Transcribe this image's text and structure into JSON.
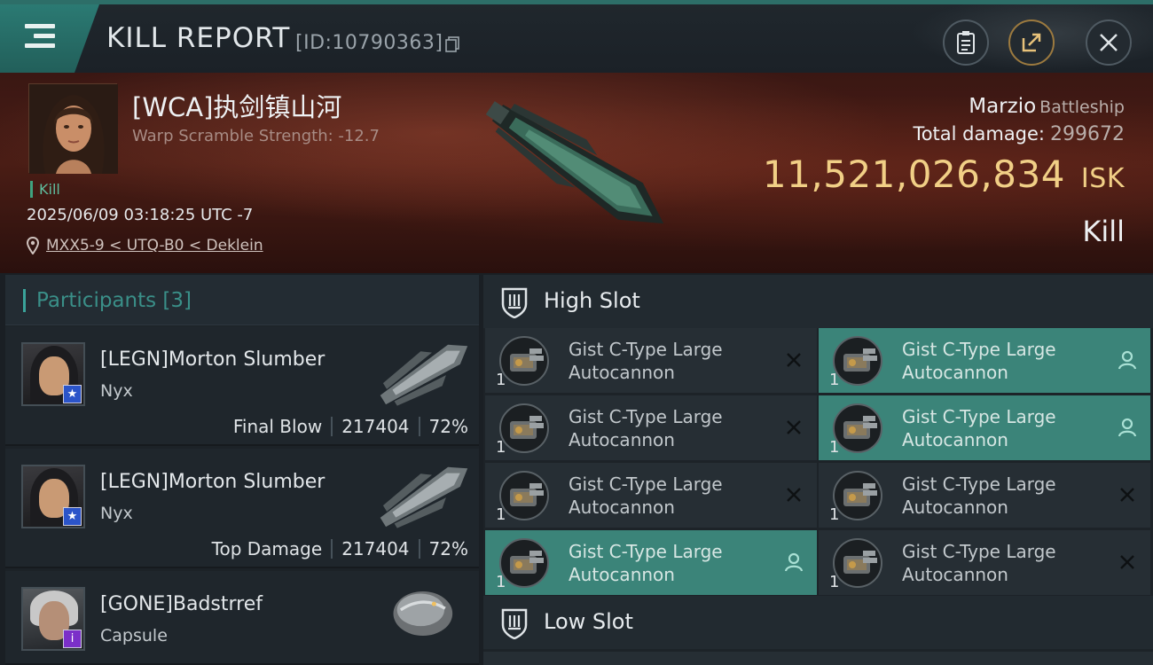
{
  "header": {
    "title": "KILL REPORT",
    "report_id": "[ID:10790363]",
    "icons": [
      "menu-icon",
      "copy-icon",
      "clipboard-icon",
      "share-icon",
      "close-icon"
    ]
  },
  "victim": {
    "name": "[WCA]执剑镇山河",
    "warp_scramble": "Warp Scramble Strength: -12.7",
    "kill_tag": "Kill",
    "timestamp": "2025/06/09 03:18:25 UTC -7",
    "location": "MXX5-9 < UTQ-B0 < Deklein",
    "ship_name": "Marzio",
    "ship_class": "Battleship",
    "total_damage_label": "Total damage:",
    "total_damage": "299672",
    "isk_value": "11,521,026,834",
    "isk_unit": "ISK",
    "result": "Kill"
  },
  "participants": {
    "label": "Participants",
    "count": "[3]",
    "rows": [
      {
        "name": "[LEGN]Morton Slumber",
        "ship": "Nyx",
        "role": "Final Blow",
        "damage": "217404",
        "percent": "72%",
        "badge": "★",
        "badge_color": "#2b54c9"
      },
      {
        "name": "[LEGN]Morton Slumber",
        "ship": "Nyx",
        "role": "Top Damage",
        "damage": "217404",
        "percent": "72%",
        "badge": "★",
        "badge_color": "#2b54c9"
      },
      {
        "name": "[GONE]Badstrref",
        "ship": "Capsule",
        "role": "",
        "damage": "",
        "percent": "",
        "badge": "i",
        "badge_color": "#7b2fc9"
      }
    ]
  },
  "slots": {
    "high_slot_label": "High Slot",
    "low_slot_label": "Low Slot",
    "modules": [
      {
        "name_line1": "Gist C-Type Large",
        "name_line2": "Autocannon",
        "qty": "1",
        "state": "destroyed",
        "active": false
      },
      {
        "name_line1": "Gist C-Type Large",
        "name_line2": "Autocannon",
        "qty": "1",
        "state": "dropped",
        "active": true
      },
      {
        "name_line1": "Gist C-Type Large",
        "name_line2": "Autocannon",
        "qty": "1",
        "state": "destroyed",
        "active": false
      },
      {
        "name_line1": "Gist C-Type Large",
        "name_line2": "Autocannon",
        "qty": "1",
        "state": "dropped",
        "active": true
      },
      {
        "name_line1": "Gist C-Type Large",
        "name_line2": "Autocannon",
        "qty": "1",
        "state": "destroyed",
        "active": false
      },
      {
        "name_line1": "Gist C-Type Large",
        "name_line2": "Autocannon",
        "qty": "1",
        "state": "destroyed",
        "active": false
      },
      {
        "name_line1": "Gist C-Type Large",
        "name_line2": "Autocannon",
        "qty": "1",
        "state": "dropped",
        "active": true
      },
      {
        "name_line1": "Gist C-Type Large",
        "name_line2": "Autocannon",
        "qty": "1",
        "state": "destroyed",
        "active": false
      }
    ]
  },
  "colors": {
    "accent_teal": "#3b8479",
    "isk_gold": "#f1cf86",
    "banner_red": "#4a1d15"
  }
}
